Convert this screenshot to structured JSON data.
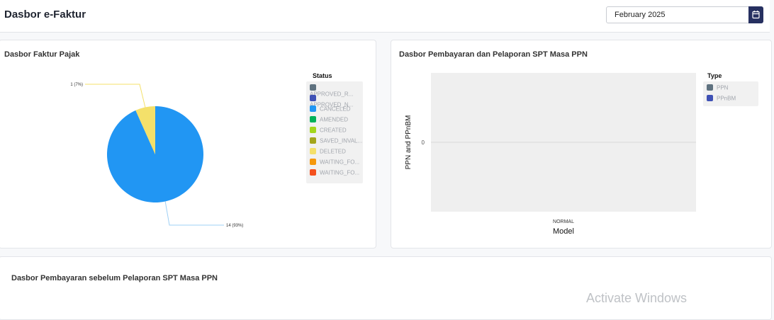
{
  "header": {
    "title": "Dasbor e-Faktur",
    "date_value": "February 2025"
  },
  "icons": {
    "calendar": "calendar-icon"
  },
  "faktur_card": {
    "title": "Dasbor Faktur Pajak",
    "legend_title": "Status",
    "legend_items": [
      {
        "label": "APPROVED_R...",
        "color": "#5f7280"
      },
      {
        "label": "APPROVED_N...",
        "color": "#3f51b5"
      },
      {
        "label": "CANCELED",
        "color": "#2196f3"
      },
      {
        "label": "AMENDED",
        "color": "#00b15a"
      },
      {
        "label": "CREATED",
        "color": "#a3d61b"
      },
      {
        "label": "SAVED_INVAL...",
        "color": "#a3a51b"
      },
      {
        "label": "DELETED",
        "color": "#f4e06a"
      },
      {
        "label": "WAITING_FO...",
        "color": "#f5980b"
      },
      {
        "label": "WAITING_FO...",
        "color": "#f4511e"
      }
    ]
  },
  "ppn_card": {
    "title": "Dasbor Pembayaran dan Pelaporan SPT Masa PPN",
    "legend_title": "Type",
    "legend_items": [
      {
        "label": "PPN",
        "color": "#5f7280"
      },
      {
        "label": "PPnBM",
        "color": "#3f51b5"
      }
    ]
  },
  "before_card": {
    "title": "Dasbor Pembayaran sebelum Pelaporan SPT Masa PPN"
  },
  "watermark": {
    "text": "Activate Windows"
  },
  "chart_data": [
    {
      "type": "pie",
      "title": "Dasbor Faktur Pajak",
      "legend_title": "Status",
      "slices": [
        {
          "name": "CANCELED",
          "value": 14,
          "label": "14 (93%)",
          "color": "#2196f3"
        },
        {
          "name": "DELETED",
          "value": 1,
          "label": "1 (7%)",
          "color": "#f4e06a"
        }
      ]
    },
    {
      "type": "bar",
      "title": "Dasbor Pembayaran dan Pelaporan SPT Masa PPN",
      "categories": [
        "NORMAL"
      ],
      "xlabel": "Model",
      "ylabel": "PPN and PPnBM",
      "yticks": [
        "0"
      ],
      "series": [
        {
          "name": "PPN",
          "values": [
            0
          ],
          "color": "#5f7280"
        },
        {
          "name": "PPnBM",
          "values": [
            0
          ],
          "color": "#3f51b5"
        }
      ]
    }
  ]
}
